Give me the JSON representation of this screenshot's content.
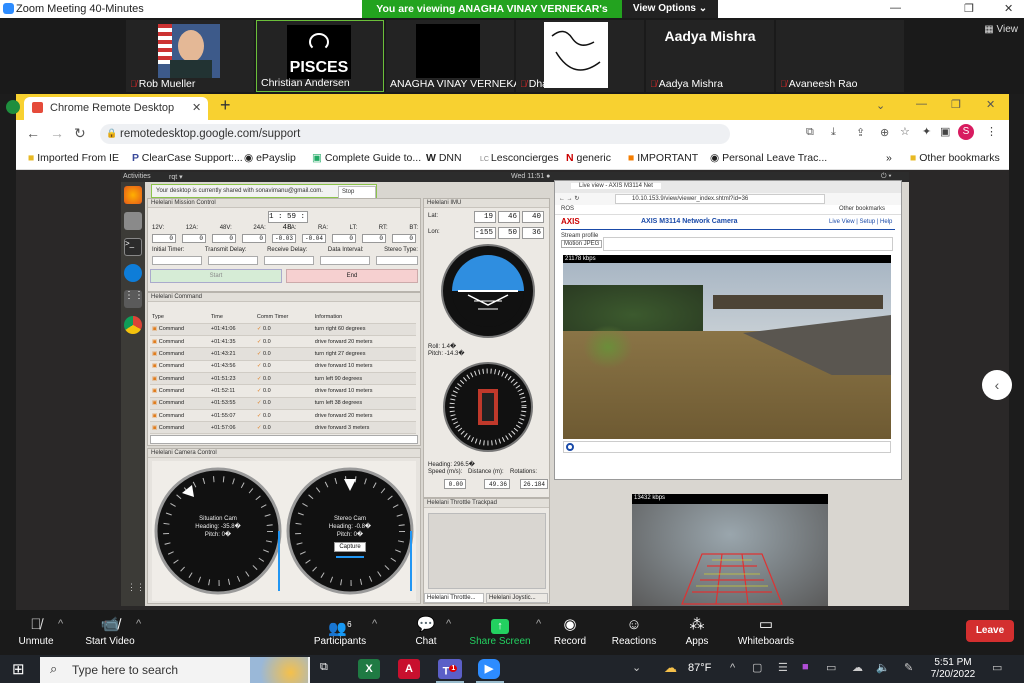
{
  "zoom": {
    "window_title": "Zoom Meeting 40-Minutes",
    "viewing_banner": "You are viewing ANAGHA VINAY VERNEKAR's screen",
    "view_options": "View Options ⌄",
    "view_button": "View",
    "participants": [
      {
        "name": "Rob Mueller",
        "muted": true
      },
      {
        "name": "Christian Andersen",
        "muted": false,
        "tile_text": "PISCES"
      },
      {
        "name": "ANAGHA VINAY VERNEKAR",
        "muted": false
      },
      {
        "name": "Dhanush",
        "muted": true
      },
      {
        "name": "Aadya Mishra",
        "muted": true,
        "tile_text": "Aadya Mishra"
      },
      {
        "name": "Avaneesh Rao",
        "muted": true
      }
    ],
    "toolbar": {
      "unmute": "Unmute",
      "start_video": "Start Video",
      "participants": "Participants",
      "participants_count": "6",
      "chat": "Chat",
      "share_screen": "Share Screen",
      "record": "Record",
      "reactions": "Reactions",
      "apps": "Apps",
      "whiteboards": "Whiteboards",
      "leave": "Leave"
    }
  },
  "chrome": {
    "tab_title": "Chrome Remote Desktop",
    "url": "remotedesktop.google.com/support",
    "profile_initial": "S",
    "bookmarks": [
      "Imported From IE",
      "ClearCase Support:...",
      "ePayslip",
      "Complete Guide to...",
      "DNN",
      "Lesconcierges",
      "generic",
      "IMPORTANT",
      "Personal Leave Trac..."
    ],
    "more_bookmarks": "»",
    "other_bookmarks": "Other bookmarks"
  },
  "remote": {
    "activities": "Activities",
    "app_name": "rqt ▾",
    "clock": "Wed 11:51 ●",
    "share_notice": "Your desktop is currently shared with sonavimanu@gmail.com.",
    "stop_sharing": "Stop Sharing",
    "mission": {
      "title": "Helelani Mission Control",
      "timer": "1 : 59 : 48",
      "labels": [
        "12V:",
        "12A:",
        "48V:",
        "24A:",
        "LA:",
        "RA:",
        "LT:",
        "RT:",
        "BT:"
      ],
      "values": [
        "0",
        "0",
        "0",
        "0",
        "-0.03",
        "-0.04",
        "0",
        "0",
        "0"
      ],
      "fields": [
        "Initial Timer:",
        "Transmit Delay:",
        "Receive Delay:",
        "Data Interval:",
        "Stereo Type:"
      ],
      "start": "Start",
      "end": "End"
    },
    "imu": {
      "title": "Helelani IMU",
      "lat_label": "Lat:",
      "lat": [
        "19",
        "46",
        "40"
      ],
      "lon_label": "Lon:",
      "lon": [
        "-155",
        "50",
        "36"
      ],
      "roll": "Roll: 1.4�",
      "pitch": "Pitch: -14.3�",
      "heading": "Heading: 296.5�",
      "speed_label": "Speed (m/s):",
      "speed": "0.00",
      "distance_label": "Distance (m):",
      "distance": "49.36",
      "rotations_label": "Rotations:",
      "rotations": "26.184"
    },
    "command": {
      "title": "Helelani Command",
      "headers": [
        "Type",
        "Time",
        "Comm Timer",
        "Information"
      ],
      "rows": [
        [
          "Command",
          "+01:41:06",
          "0.0",
          "turn right 60 degrees"
        ],
        [
          "Command",
          "+01:41:35",
          "0.0",
          "drive forward 20 meters"
        ],
        [
          "Command",
          "+01:43:21",
          "0.0",
          "turn right 27 degrees"
        ],
        [
          "Command",
          "+01:43:56",
          "0.0",
          "drive forward 10 meters"
        ],
        [
          "Command",
          "+01:51:23",
          "0.0",
          "turn left 90 degrees"
        ],
        [
          "Command",
          "+01:52:11",
          "0.0",
          "drive forward 10 meters"
        ],
        [
          "Command",
          "+01:53:55",
          "0.0",
          "turn left 38 degrees"
        ],
        [
          "Command",
          "+01:55:07",
          "0.0",
          "drive forward 20 meters"
        ],
        [
          "Command",
          "+01:57:06",
          "0.0",
          "drive forward 3 meters"
        ]
      ]
    },
    "camera": {
      "title": "Helelani Camera Control",
      "situation": {
        "name": "Situation Cam",
        "heading": "Heading: -35.8�",
        "pitch": "Pitch: 0�"
      },
      "stereo": {
        "name": "Stereo Cam",
        "heading": "Heading: -0.8�",
        "pitch": "Pitch: 0�",
        "capture": "Capture"
      }
    },
    "throttle": {
      "title": "Helelani Throttle Trackpad",
      "tabs": [
        "Helelani Throttle...",
        "Helelani Joystic..."
      ]
    },
    "live": {
      "tab": "Live view - AXIS M3114 Net",
      "url": "10.10.153.9/view/viewer_index.shtml?id=36",
      "bookmark": "ROS",
      "other_bookmarks": "Other bookmarks",
      "header": "AXIS M3114 Network Camera",
      "links": "Live View | Setup | Help",
      "stream_label": "Stream profile",
      "stream_value": "Motion JPEG",
      "kbps1": "21178 kbps",
      "kbps2": "13432 kbps"
    }
  },
  "taskbar": {
    "search": "Type here to search",
    "temp": "87°F",
    "time": "5:51 PM",
    "date": "7/20/2022",
    "teams_badge": "1"
  }
}
